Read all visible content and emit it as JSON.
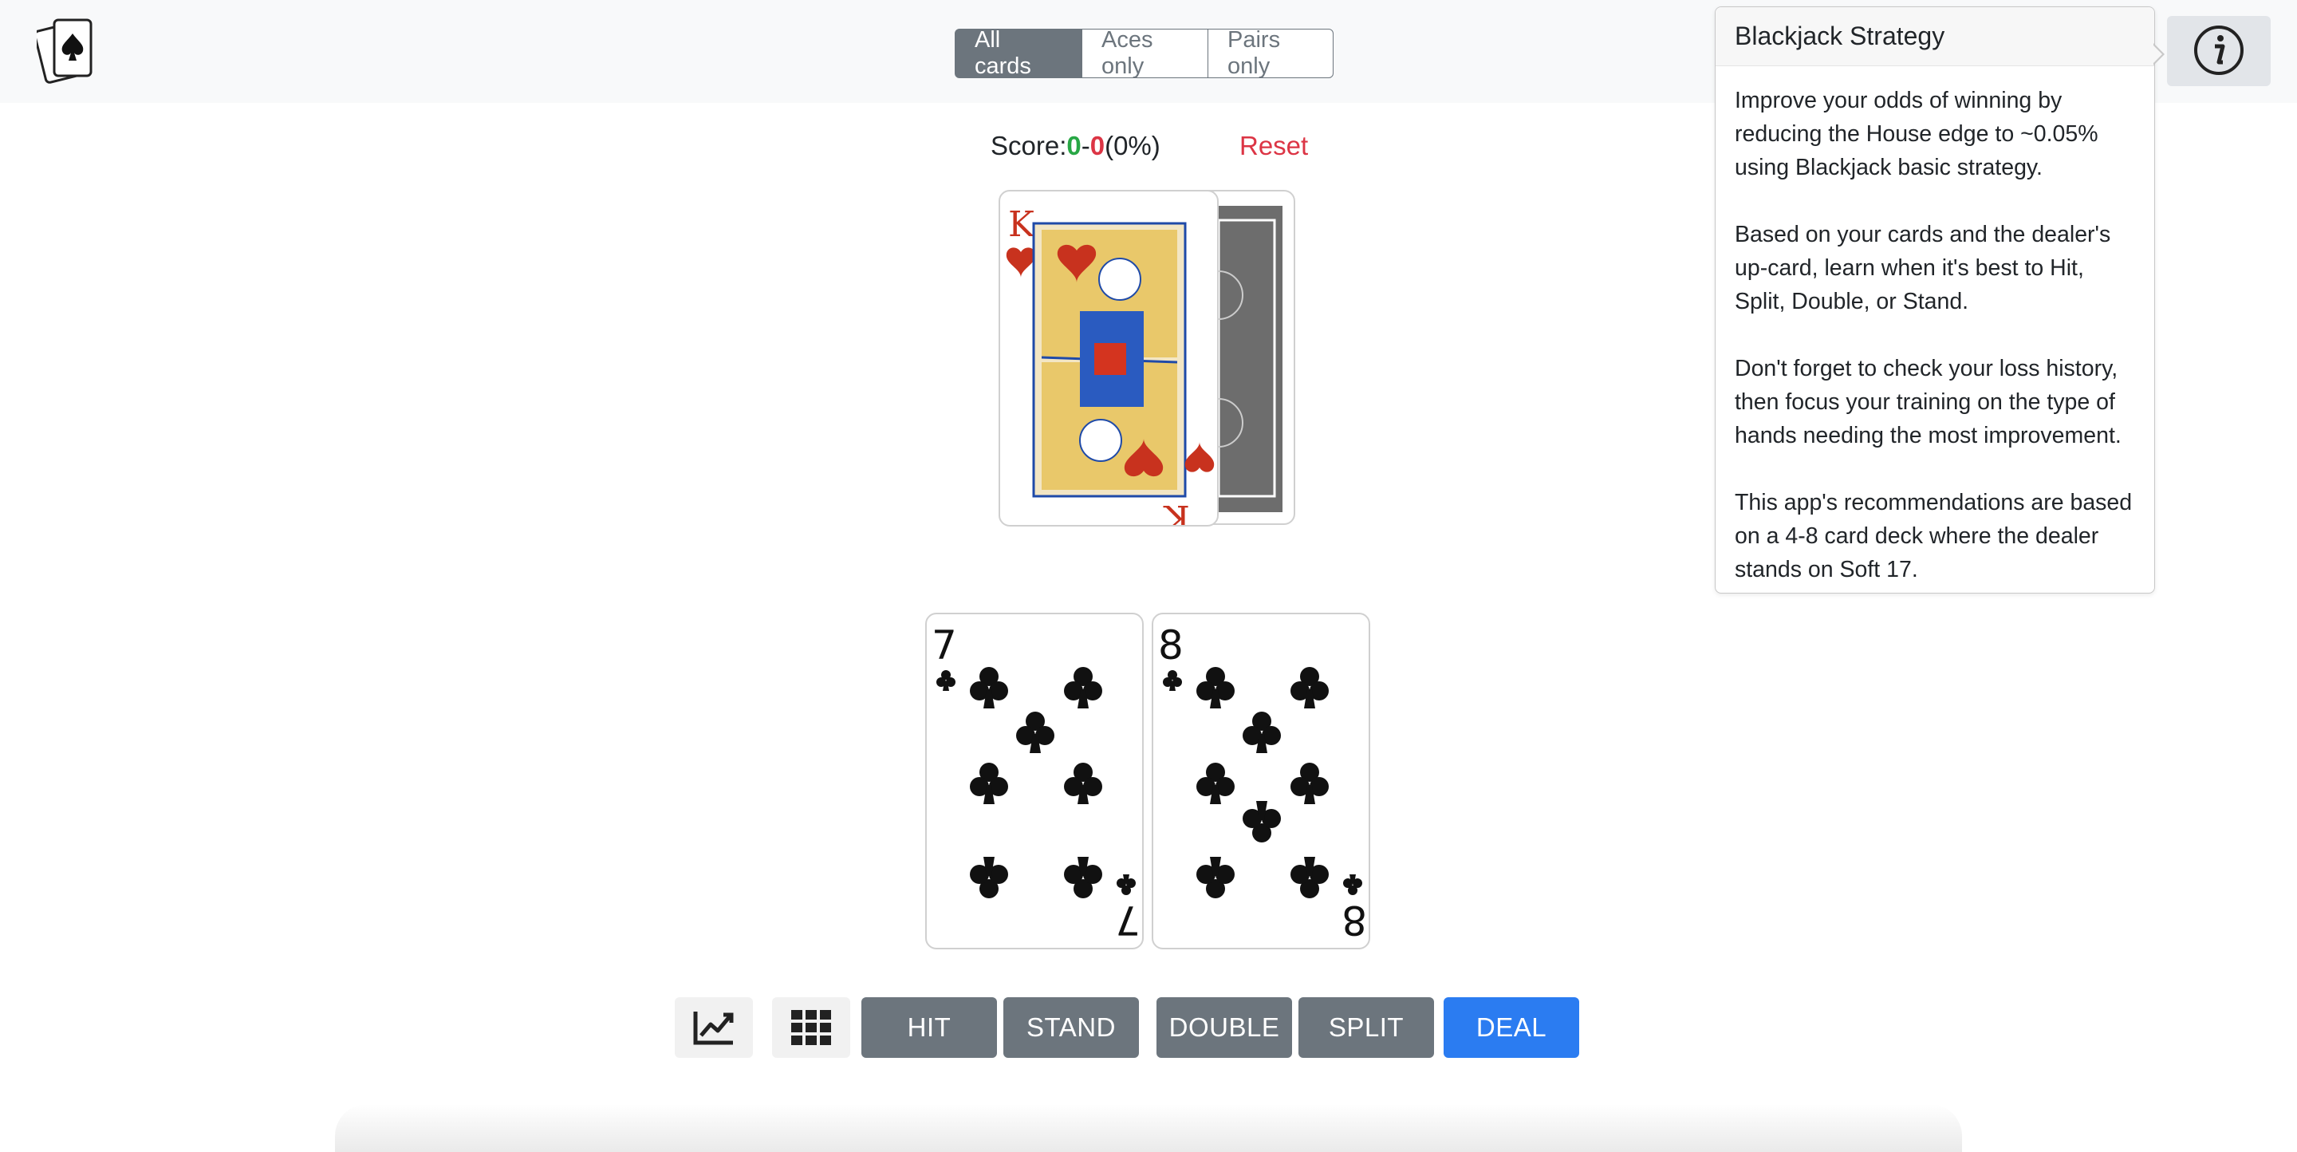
{
  "header": {
    "logo_icon": "playing-cards-spade-icon",
    "modes": [
      {
        "label": "All cards",
        "active": true
      },
      {
        "label": "Aces only",
        "active": false
      },
      {
        "label": "Pairs only",
        "active": false
      }
    ],
    "info_icon": "info-icon"
  },
  "popover": {
    "title": "Blackjack Strategy",
    "paragraphs": [
      "Improve your odds of winning by reducing the House edge to ~0.05% using Blackjack basic strategy.",
      "Based on your cards and the dealer's up-card, learn when it's best to Hit, Split, Double, or Stand.",
      "Don't forget to check your loss history, then focus your training on the type of hands needing the most improvement.",
      "This app's recommendations are based on a 4-8 card deck where the dealer stands on Soft 17."
    ]
  },
  "score": {
    "label": "Score:",
    "wins": "0",
    "separator": "-",
    "losses": "0",
    "percent": "(0%)",
    "reset_label": "Reset"
  },
  "dealer": {
    "up_card": {
      "rank": "K",
      "suit": "hearts"
    },
    "hole_card": "face-down"
  },
  "player": {
    "cards": [
      {
        "rank": "7",
        "suit": "clubs"
      },
      {
        "rank": "8",
        "suit": "clubs"
      }
    ]
  },
  "actions": {
    "chart_icon": "line-chart-icon",
    "grid_icon": "grid-icon",
    "hit": "HIT",
    "stand": "STAND",
    "double": "DOUBLE",
    "split": "SPLIT",
    "deal": "DEAL"
  },
  "colors": {
    "win": "#28a745",
    "loss": "#dc3545",
    "secondary": "#6c757d",
    "primary": "#2b7cf1"
  }
}
